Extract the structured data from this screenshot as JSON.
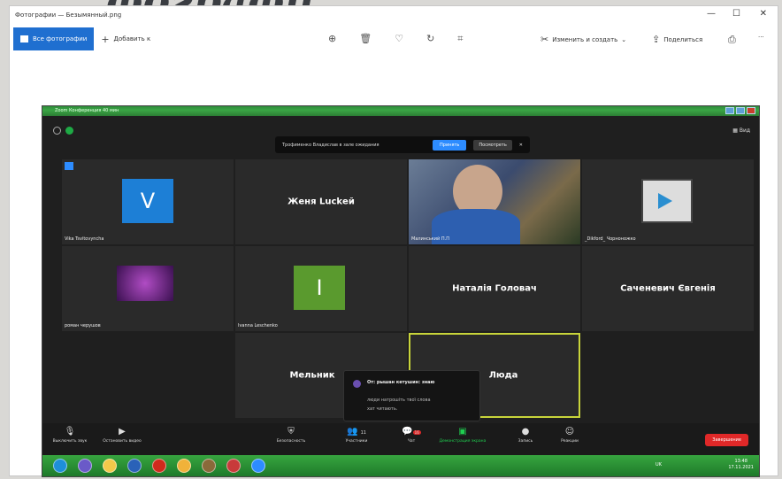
{
  "deco": {
    "title": "фографи"
  },
  "window": {
    "title": "Фотографии — Безымянный.png",
    "minimize": "—",
    "maximize": "☐",
    "close": "✕"
  },
  "toolbar": {
    "all_photos": "Все фотографии",
    "add_to": "Добавить к",
    "edit_create": "Изменить и создать",
    "share": "Поделиться",
    "more": "···"
  },
  "zoom": {
    "window_title": "Zoom Конференция 40 мин",
    "view_label": "Вид",
    "waiting_notice": "Трофименко Владислав в зале ожидания",
    "admit": "Принять",
    "view": "Посмотреть",
    "notice_close": "✕",
    "tiles": [
      {
        "name": "Vika Tsvitovyncha",
        "avatar_letter": "V",
        "avatar_color": "#1d7fd6"
      },
      {
        "name": "",
        "center_text": "Женя Luckей"
      },
      {
        "name": "Малинський П.П"
      },
      {
        "name": "_Dikford_ Чорноножко"
      },
      {
        "name": "роман черушов"
      },
      {
        "name": "Ivanna Leschenko",
        "avatar_letter": "I",
        "avatar_color": "#5a9a2e"
      },
      {
        "name": "",
        "center_text": "Наталія Головач"
      },
      {
        "name": "",
        "center_text": "Саченевич Євгенія"
      },
      {
        "name": "",
        "center_text": "Мельник"
      },
      {
        "name": "",
        "center_text": "Люда"
      }
    ],
    "chat": {
      "from": "От: рышан кетушин: знаю",
      "line1": "люди натрошіть твої слова",
      "line2": "хат читають."
    },
    "controls": {
      "mute": "Выключить звук",
      "video": "Остановить видео",
      "security": "Безопасность",
      "participants": "Участники",
      "participants_count": "11",
      "chat": "Чат",
      "chat_badge": "16",
      "share": "Демонстрация экрана",
      "record": "Запись",
      "reactions": "Реакции",
      "end": "Завершение"
    },
    "tray": {
      "lang": "UK",
      "time": "13:48",
      "date": "17.11.2021"
    }
  }
}
